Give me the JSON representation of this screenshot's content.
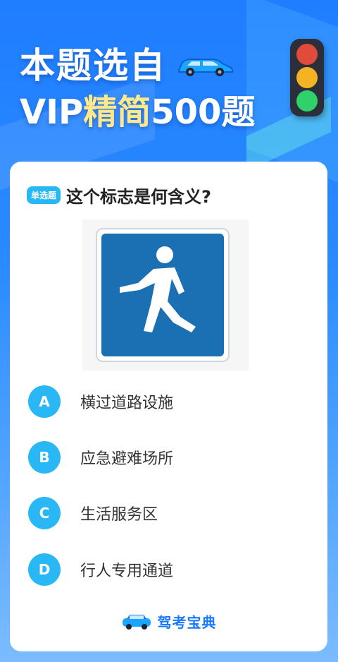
{
  "header": {
    "line1": "本题选自",
    "line2_prefix": "VIP",
    "line2_accent": "精简",
    "line2_suffix": "500题"
  },
  "question": {
    "badge": "单选题",
    "text": "这个标志是何含义?"
  },
  "options": [
    {
      "letter": "A",
      "text": "横过道路设施"
    },
    {
      "letter": "B",
      "text": "应急避难场所"
    },
    {
      "letter": "C",
      "text": "生活服务区"
    },
    {
      "letter": "D",
      "text": "行人专用通道"
    }
  ],
  "brand": {
    "name": "驾考宝典"
  },
  "colors": {
    "background": "#2a8bff",
    "accent_text": "#ffe98a",
    "option_bubble": "#2ab7f6",
    "sign_blue": "#1b6fb3",
    "brand": "#1677ff"
  },
  "icons": {
    "car": "car-icon",
    "traffic_light": "traffic-light-icon",
    "pedestrian": "pedestrian-sign-icon"
  }
}
